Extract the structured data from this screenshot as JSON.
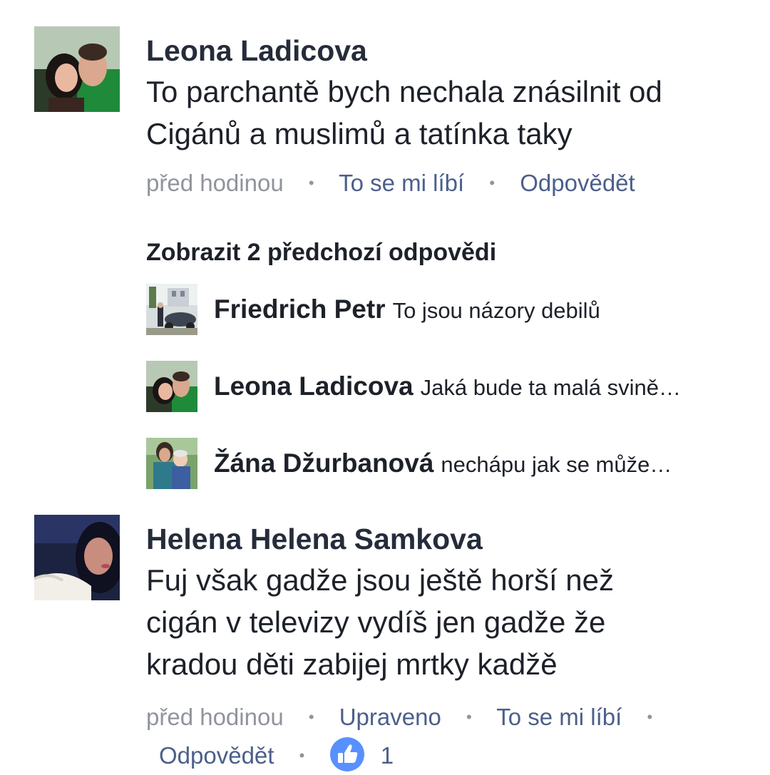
{
  "comments": [
    {
      "author": "Leona Ladicova",
      "text": "To parchantě bych nechala znásilnit od Cigánů a muslimů a tatínka taky",
      "time": "před hodinou",
      "like_label": "To se mi líbí",
      "reply_label": "Odpovědět"
    },
    {
      "author": "Helena Helena Samkova",
      "text": "Fuj však gadže jsou ještě horší než cigán v televizy vydíš jen gadže že kradou děti zabijej mrtky kadžě",
      "time": "před hodinou",
      "edited_label": "Upraveno",
      "like_label": "To se mi líbí",
      "reply_label": "Odpovědět",
      "like_count": "1"
    }
  ],
  "replies": {
    "show_previous_label": "Zobrazit 2 předchozí odpovědi",
    "items": [
      {
        "author": "Friedrich Petr",
        "text": "To jsou názory debilů"
      },
      {
        "author": "Leona Ladicova",
        "text": "Jaká bude ta malá svině…"
      },
      {
        "author": "Žána Džurbanová",
        "text": "nechápu jak se může…"
      }
    ]
  },
  "colors": {
    "link": "#4b5f8a",
    "meta": "#90949c",
    "like_badge": "#5890ff"
  },
  "icons": {
    "dot": "•",
    "like": "thumbs-up-icon"
  }
}
